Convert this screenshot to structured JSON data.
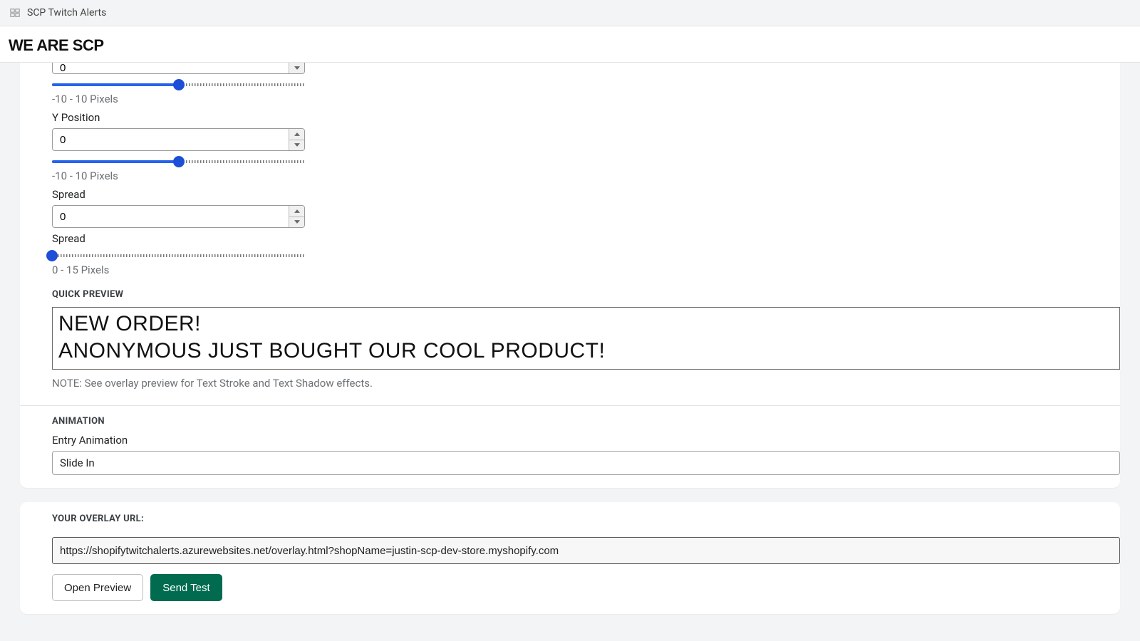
{
  "titlebar": {
    "app_name": "SCP Twitch Alerts"
  },
  "brand": {
    "logo_text": "WE ARE SCP"
  },
  "controls": {
    "xpos": {
      "value": "0",
      "range_caption": "-10 - 10 Pixels",
      "slider_percent": 50
    },
    "ypos": {
      "label": "Y Position",
      "value": "0",
      "range_caption": "-10 - 10 Pixels",
      "slider_percent": 50
    },
    "spread": {
      "label": "Spread",
      "value": "0",
      "label2": "Spread",
      "range_caption": "0 - 15 Pixels",
      "slider_percent": 0
    }
  },
  "quick_preview": {
    "title": "QUICK PREVIEW",
    "line1": "NEW ORDER!",
    "line2": "ANONYMOUS JUST BOUGHT OUR COOL PRODUCT!",
    "note": "NOTE: See overlay preview for Text Stroke and Text Shadow effects."
  },
  "animation": {
    "title": "ANIMATION",
    "entry_label": "Entry Animation",
    "entry_value": "Slide In"
  },
  "overlay": {
    "title": "YOUR OVERLAY URL:",
    "url": "https://shopifytwitchalerts.azurewebsites.net/overlay.html?shopName=justin-scp-dev-store.myshopify.com",
    "open_preview": "Open Preview",
    "send_test": "Send Test"
  }
}
